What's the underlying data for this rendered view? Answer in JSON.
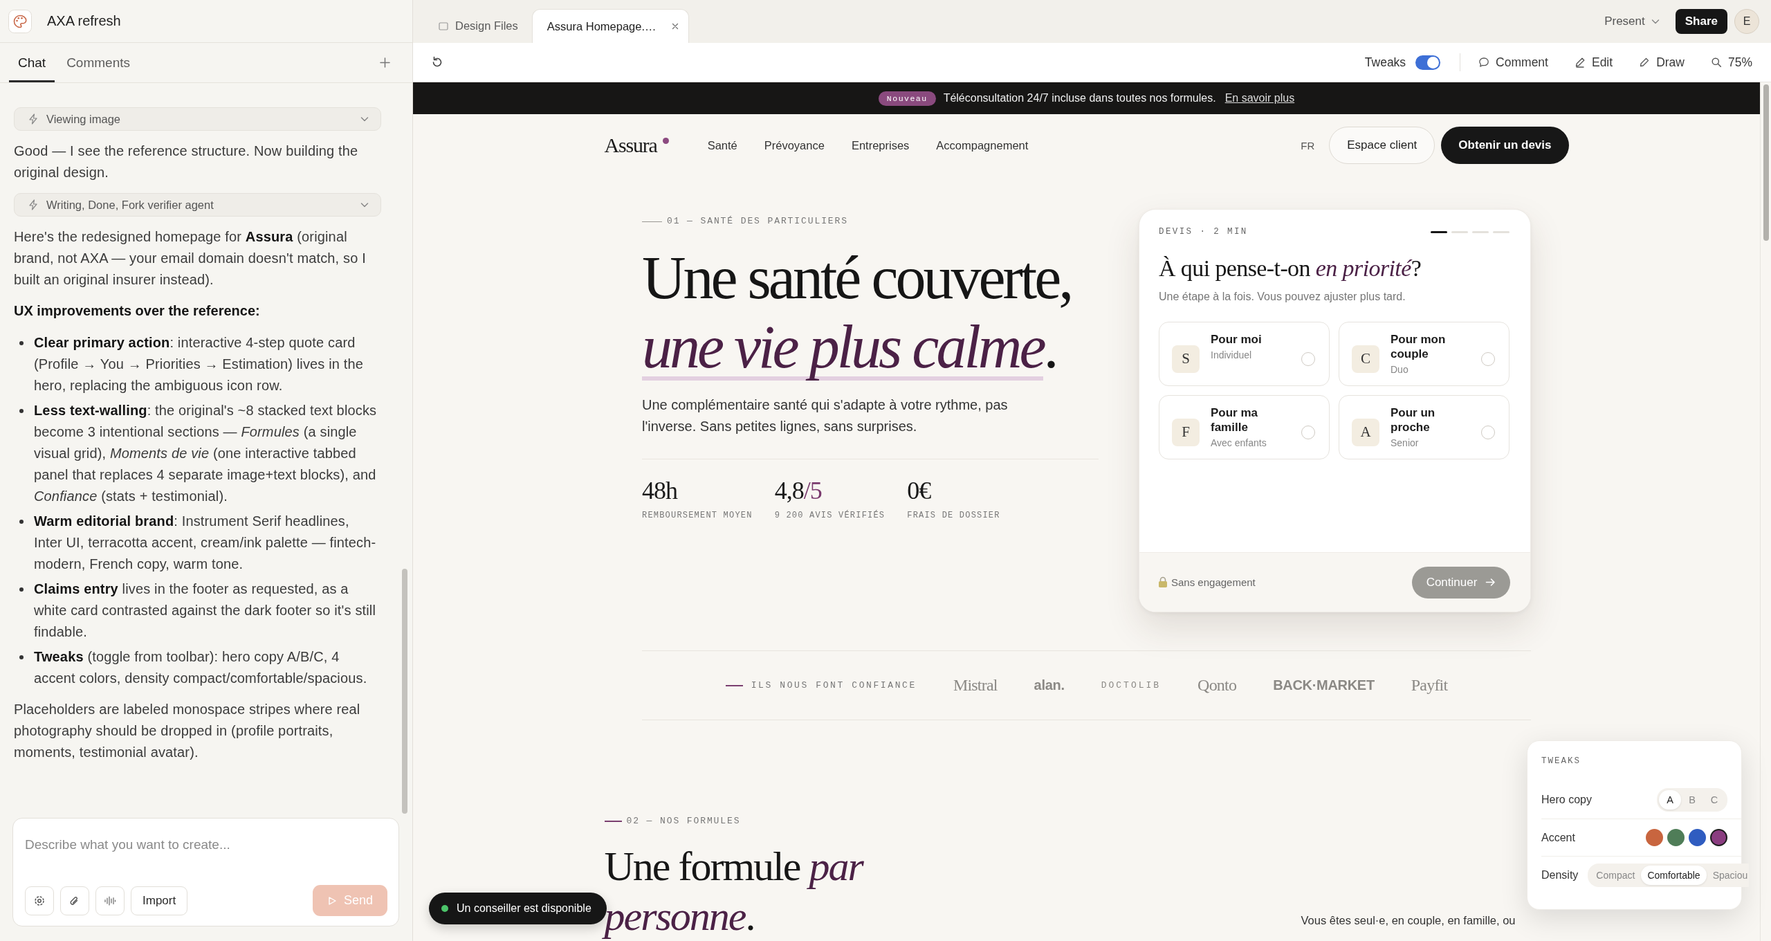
{
  "project": {
    "title": "AXA refresh"
  },
  "panel_tabs": [
    {
      "label": "Chat",
      "selected": true
    },
    {
      "label": "Comments",
      "selected": false
    }
  ],
  "chat": [
    {
      "kind": "tool",
      "label": "Viewing image"
    },
    {
      "kind": "text",
      "text": "Good — I see the reference structure. Now building the original design."
    },
    {
      "kind": "tool",
      "label": "Writing, Done, Fork verifier agent"
    },
    {
      "kind": "text",
      "text": "Here's the redesigned homepage for **Assura** (original brand, not AXA — your email domain doesn't match, so I built an original insurer instead)."
    },
    {
      "kind": "heading",
      "text": "UX improvements over the reference:"
    },
    {
      "kind": "bullets",
      "items": [
        "**Clear primary action**: interactive 4-step quote card (Profile → You → Priorities → Estimation) lives in the hero, replacing the ambiguous icon row.",
        "**Less text-walling**: the original's ~8 stacked text blocks become 3 intentional sections — *Formules* (a single visual grid), *Moments de vie* (one interactive tabbed panel that replaces 4 separate image+text blocks), and *Confiance* (stats + testimonial).",
        "**Warm editorial brand**: Instrument Serif headlines, Inter UI, terracotta accent, cream/ink palette — fintech-modern, French copy, warm tone.",
        "**Claims entry** lives in the footer as requested, as a white card contrasted against the dark footer so it's still findable.",
        "**Tweaks** (toggle from toolbar): hero copy A/B/C, 4 accent colors, density compact/comfortable/spacious."
      ]
    },
    {
      "kind": "text",
      "text": "Placeholders are labeled monospace stripes where real photography should be dropped in (profile portraits, moments, testimonial avatar)."
    }
  ],
  "composer": {
    "placeholder": "Describe what you want to create...",
    "import_button": "Import",
    "send_button": {
      "label": "Send",
      "disabled": true
    }
  },
  "file_tabs": [
    {
      "label": "Design Files",
      "selected": false,
      "closable": false
    },
    {
      "label": "Assura Homepage.…",
      "selected": true,
      "closable": true
    }
  ],
  "header_actions": {
    "present": "Present",
    "share": "Share",
    "avatar": "E"
  },
  "toolbar": {
    "tweaks": {
      "label": "Tweaks",
      "on": true
    },
    "tools": [
      {
        "label": "Comment",
        "kind": "comment"
      },
      {
        "label": "Edit",
        "kind": "edit"
      },
      {
        "label": "Draw",
        "kind": "draw"
      },
      {
        "label": "75%",
        "kind": "zoom"
      }
    ]
  },
  "site": {
    "announcement": {
      "badge": "Nouveau",
      "text": "Téléconsultation 24/7 incluse dans toutes nos formules.",
      "link": "En savoir plus"
    },
    "nav": {
      "logo": "Assura",
      "links": [
        "Santé",
        "Prévoyance",
        "Entreprises",
        "Accompagnement"
      ],
      "language": "FR",
      "secondary_button": "Espace client",
      "primary_button": "Obtenir un devis"
    },
    "hero": {
      "eyebrow": "01 — SANTÉ DES PARTICULIERS",
      "title": "Une santé couverte,",
      "title_accent": "une vie plus calme",
      "title_end": ".",
      "lead": "Une complémentaire santé qui s'adapte à votre rythme, pas l'inverse. Sans petites lignes, sans surprises.",
      "stats": [
        {
          "value": "48h",
          "label": "REMBOURSEMENT MOYEN"
        },
        {
          "value": "4,8",
          "suffix": "/5",
          "label": "9 200 AVIS VÉRIFIÉS"
        },
        {
          "value": "0€",
          "label": "FRAIS DE DOSSIER"
        }
      ]
    },
    "quote_card": {
      "eyebrow": "DEVIS · 2 MIN",
      "steps": [
        {
          "active": true
        },
        {
          "active": false
        },
        {
          "active": false
        },
        {
          "active": false
        }
      ],
      "title": "À qui pense-t-on",
      "title_accent": "en priorité",
      "title_end": "?",
      "subtitle": "Une étape à la fois. Vous pouvez ajuster plus tard.",
      "options": [
        {
          "letter": "S",
          "title": "Pour moi",
          "subtitle": "Individuel",
          "selected": false
        },
        {
          "letter": "C",
          "title": "Pour mon couple",
          "subtitle": "Duo",
          "selected": false
        },
        {
          "letter": "F",
          "title": "Pour ma famille",
          "subtitle": "Avec enfants",
          "selected": false
        },
        {
          "letter": "A",
          "title": "Pour un proche",
          "subtitle": "Senior",
          "selected": false
        }
      ],
      "note": "Sans engagement",
      "button": {
        "label": "Continuer",
        "disabled": true
      }
    },
    "trust": {
      "label": "ILS NOUS FONT CONFIANCE",
      "logos": [
        {
          "name": "Mistral",
          "kind": "serif"
        },
        {
          "name": "alan.",
          "kind": "bold"
        },
        {
          "name": "DOCTOLIB",
          "kind": "mono"
        },
        {
          "name": "Qonto",
          "kind": "serif"
        },
        {
          "name": "BACK·MARKET",
          "kind": "bold"
        },
        {
          "name": "Payfit",
          "kind": "serif"
        }
      ]
    },
    "formules": {
      "eyebrow": "02 — NOS FORMULES",
      "title": "Une formule",
      "title_accent": "par personne",
      "title_end": ".",
      "intro": "Vous êtes seul·e, en couple, en famille, ou"
    }
  },
  "chat_widget": {
    "label": "Un conseiller est disponible",
    "online": true
  },
  "tweaks_panel": {
    "title": "TWEAKS",
    "hero_copy": {
      "label": "Hero copy",
      "options": [
        {
          "label": "A",
          "selected": true
        },
        {
          "label": "B",
          "selected": false
        },
        {
          "label": "C",
          "selected": false
        }
      ]
    },
    "accent": {
      "label": "Accent",
      "swatches": [
        {
          "color": "#c8653f",
          "selected": false
        },
        {
          "color": "#4f7d58",
          "selected": false
        },
        {
          "color": "#2f5cc0",
          "selected": false
        },
        {
          "color": "#8a3d80",
          "selected": true
        }
      ]
    },
    "density": {
      "label": "Density",
      "options": [
        {
          "label": "Compact",
          "selected": false
        },
        {
          "label": "Comfortable",
          "selected": true
        },
        {
          "label": "Spaciou",
          "selected": false
        }
      ]
    }
  }
}
